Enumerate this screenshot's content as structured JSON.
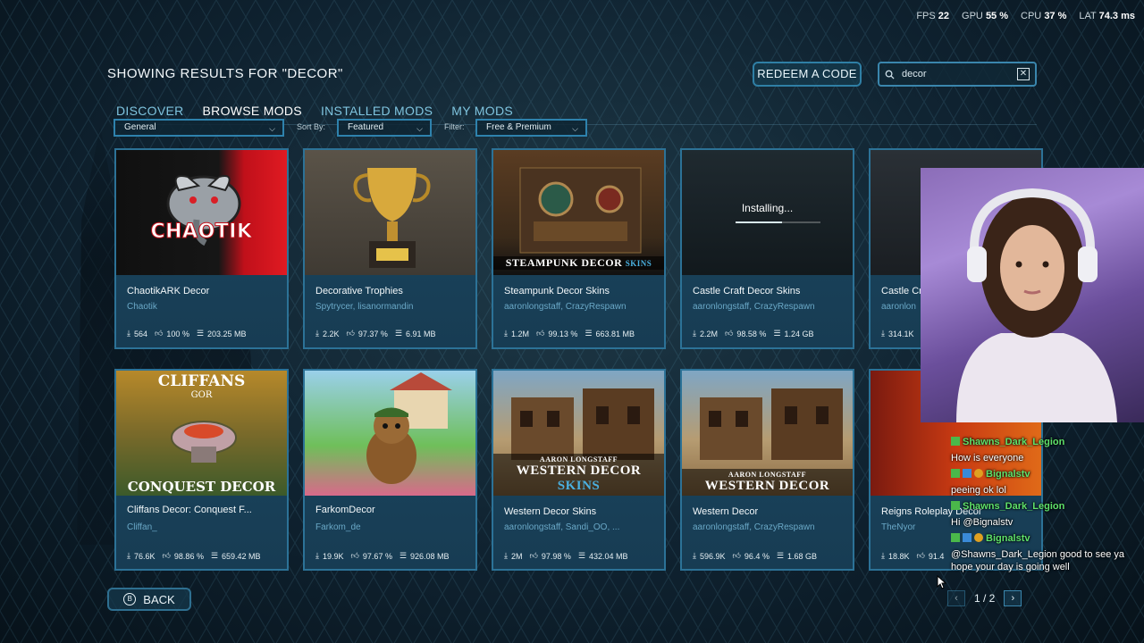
{
  "perf": {
    "fps_label": "FPS",
    "fps": "22",
    "gpu_label": "GPU",
    "gpu": "55 %",
    "cpu_label": "CPU",
    "cpu": "37 %",
    "lat_label": "LAT",
    "lat": "74.3 ms"
  },
  "header": {
    "results_title": "SHOWING RESULTS FOR \"DECOR\"",
    "redeem_label": "REDEEM A CODE",
    "search_value": "decor"
  },
  "tabs": [
    {
      "label": "DISCOVER",
      "active": false
    },
    {
      "label": "BROWSE MODS",
      "active": true
    },
    {
      "label": "INSTALLED MODS",
      "active": false
    },
    {
      "label": "MY MODS",
      "active": false
    }
  ],
  "filters": {
    "category_value": "General",
    "sort_label": "Sort By:",
    "sort_value": "Featured",
    "filter_label": "Filter:",
    "filter_value": "Free & Premium"
  },
  "cards": [
    {
      "name": "ChaotikARK Decor",
      "author": "Chaotik",
      "downloads": "564",
      "rating": "100 %",
      "size": "203.25 MB",
      "thumb": "chaotik-logo"
    },
    {
      "name": "Decorative Trophies",
      "author": "Spytrycer, lisanormandin",
      "downloads": "2.2K",
      "rating": "97.37 %",
      "size": "6.91 MB",
      "thumb": "trophy"
    },
    {
      "name": "Steampunk Decor Skins",
      "author": "aaronlongstaff, CrazyRespawn",
      "downloads": "1.2M",
      "rating": "99.13 %",
      "size": "663.81 MB",
      "thumb": "steampunk"
    },
    {
      "name": "Castle Craft Decor Skins",
      "author": "aaronlongstaff, CrazyRespawn",
      "downloads": "2.2M",
      "rating": "98.58 %",
      "size": "1.24 GB",
      "thumb": "castle-craft",
      "installing": "Installing...",
      "progress": 0.55
    },
    {
      "name": "Castle Cr",
      "author": "aaronlon",
      "downloads": "314.1K",
      "rating": "",
      "size": "",
      "thumb": "castle"
    },
    {
      "name": "Cliffans Decor: Conquest F...",
      "author": "Cliffan_",
      "downloads": "76.6K",
      "rating": "98.86 %",
      "size": "659.42 MB",
      "thumb": "cliffans"
    },
    {
      "name": "FarkomDecor",
      "author": "Farkom_de",
      "downloads": "19.9K",
      "rating": "97.67 %",
      "size": "926.08 MB",
      "thumb": "beaver"
    },
    {
      "name": "Western Decor Skins",
      "author": "aaronlongstaff, Sandi_OO, ...",
      "downloads": "2M",
      "rating": "97.98 %",
      "size": "432.04 MB",
      "thumb": "western-skins"
    },
    {
      "name": "Western Decor",
      "author": "aaronlongstaff, CrazyRespawn",
      "downloads": "596.9K",
      "rating": "96.4 %",
      "size": "1.68 GB",
      "thumb": "western"
    },
    {
      "name": "Reigns Roleplay Decor",
      "author": "TheNyor",
      "downloads": "18.8K",
      "rating": "91.4",
      "size": "",
      "thumb": "reigns"
    }
  ],
  "thumb_text": {
    "chaotik": "CHAOTIK",
    "steampunk": "STEAMPUNK DECOR",
    "steampunk_sub": "SKINS",
    "cliffans_top": "CLIFFANS",
    "cliffans_gor": "GOR",
    "cliffans_bottom": "CONQUEST DECOR",
    "aaron": "AARON LONGSTAFF",
    "western": "WESTERN DECOR",
    "western_sub": "SKINS"
  },
  "footer": {
    "back_label": "BACK",
    "back_key": "B",
    "page": "1 / 2"
  },
  "chat": [
    {
      "user": "Shawns_Dark_Legion",
      "text": ""
    },
    {
      "user": "",
      "text": "How is everyone"
    },
    {
      "user": "Bignalstv",
      "text": ""
    },
    {
      "user": "",
      "text": "peeing ok lol"
    },
    {
      "user": "Shawns_Dark_Legion",
      "text": ""
    },
    {
      "user": "",
      "text": "Hi @Bignalstv"
    },
    {
      "user": "Bignalstv",
      "text": ""
    },
    {
      "user": "",
      "text": "@Shawns_Dark_Legion good to see ya hope your day is going well"
    }
  ],
  "colors": {
    "accent": "#2c7297",
    "link": "#6aa8c7",
    "chat_user": "#5fe26b"
  }
}
